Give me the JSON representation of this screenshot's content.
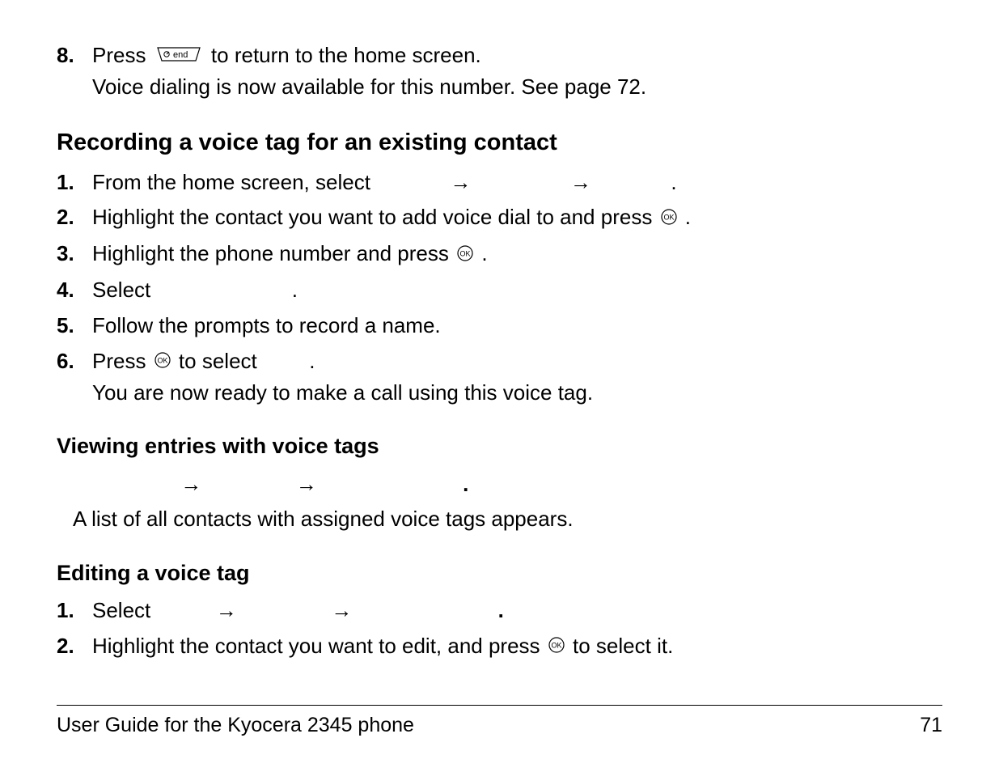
{
  "step8": {
    "num": "8.",
    "text_before": "Press ",
    "text_after": " to return to the home screen.",
    "line2": "Voice dialing is now available for this number. See page 72."
  },
  "section1": {
    "heading": "Recording a voice tag for an existing contact",
    "items": [
      {
        "num": "1.",
        "text_before": "From the home screen, select ",
        "arrows": 2,
        "text_after": "."
      },
      {
        "num": "2.",
        "text": "Highlight the contact you want to add voice dial to and press ",
        "has_ok": true,
        "suffix": "."
      },
      {
        "num": "3.",
        "text": "Highlight the phone number and press ",
        "has_ok": true,
        "suffix": "."
      },
      {
        "num": "4.",
        "text": "Select ",
        "gap": true,
        "suffix": "."
      },
      {
        "num": "5.",
        "text": "Follow the prompts to record a name."
      },
      {
        "num": "6.",
        "text_before": "Press ",
        "has_ok": true,
        "text_after": " to select ",
        "gap": true,
        "suffix": ".",
        "line2": "You are now ready to make a call using this voice tag."
      }
    ]
  },
  "section2": {
    "heading": "Viewing entries with voice tags",
    "nav_period": ".",
    "body": "A list of all contacts with assigned voice tags appears."
  },
  "section3": {
    "heading": "Editing a voice tag",
    "items": [
      {
        "num": "1.",
        "text": "Select ",
        "arrows": 2,
        "suffix": "."
      },
      {
        "num": "2.",
        "text_before": "Highlight the contact you want to edit, and press ",
        "has_ok": true,
        "text_after": " to select it."
      }
    ]
  },
  "footer": {
    "left": "User Guide for the Kyocera 2345 phone",
    "right": "71"
  },
  "arrow_glyph": "→"
}
